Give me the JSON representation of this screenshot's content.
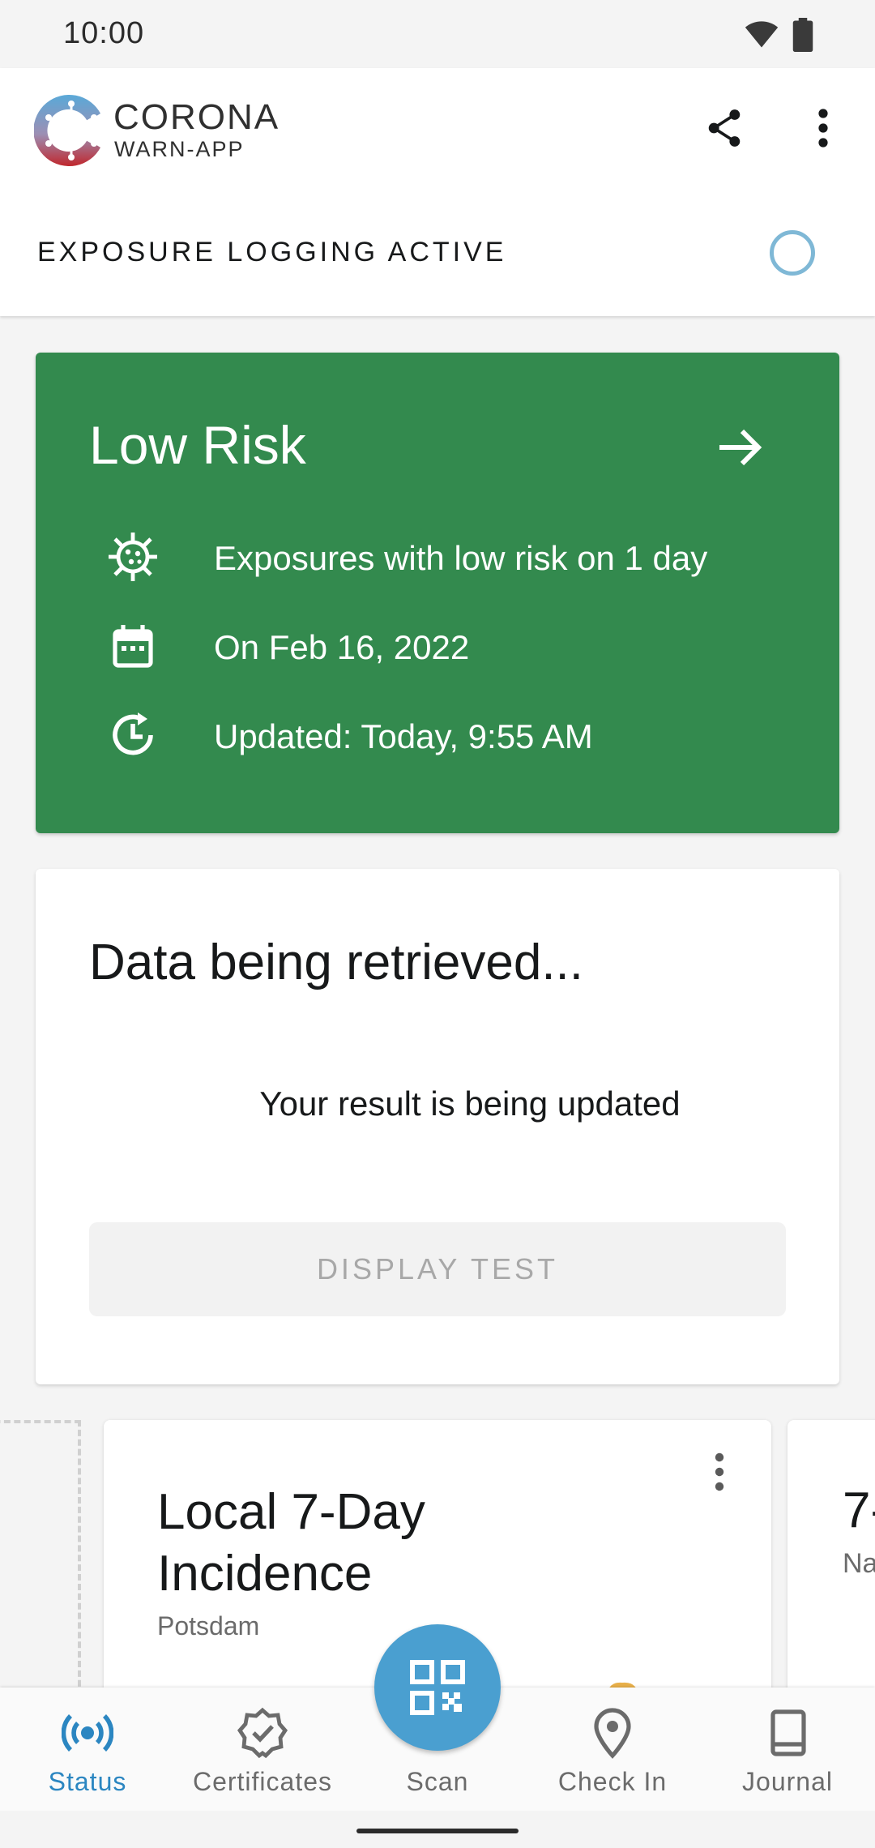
{
  "status_bar": {
    "time": "10:00"
  },
  "header": {
    "logo_line1": "CORONA",
    "logo_line2": "WARN-APP",
    "logging_status": "EXPOSURE LOGGING ACTIVE"
  },
  "risk_card": {
    "title": "Low Risk",
    "rows": [
      {
        "icon": "virus-icon",
        "text": "Exposures with low risk on 1 day"
      },
      {
        "icon": "calendar-icon",
        "text": "On Feb 16, 2022"
      },
      {
        "icon": "clock-update-icon",
        "text": "Updated: Today, 9:55 AM"
      }
    ],
    "color": "#338a4e"
  },
  "data_card": {
    "title": "Data being retrieved...",
    "subtitle": "Your result is being updated",
    "button_label": "DISPLAY TEST"
  },
  "incidence_card": {
    "title": "Local 7-Day Incidence",
    "location": "Potsdam"
  },
  "next_card": {
    "title_partial": "7-",
    "sub_partial": "Na"
  },
  "bottom_nav": {
    "items": [
      {
        "label": "Status",
        "icon": "status-broadcast-icon",
        "active": true
      },
      {
        "label": "Certificates",
        "icon": "certificate-badge-icon",
        "active": false
      },
      {
        "label": "Scan",
        "icon": "qr-code-icon",
        "active": false
      },
      {
        "label": "Check In",
        "icon": "location-pin-icon",
        "active": false
      },
      {
        "label": "Journal",
        "icon": "book-icon",
        "active": false
      }
    ],
    "active_color": "#2b86c1",
    "fab_color": "#4a9fd0"
  }
}
